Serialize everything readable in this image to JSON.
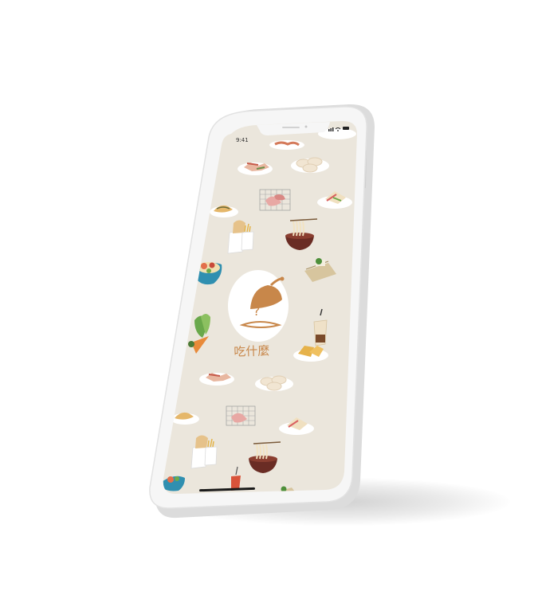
{
  "status_bar": {
    "time": "9:41"
  },
  "app": {
    "name": "吃什麼",
    "question_mark": "?",
    "brand_color": "#c8874a",
    "background_color": "#ebe6dc",
    "logo_icon": "cloche-dome-icon"
  },
  "device": {
    "frame_color": "#f4f4f4",
    "body_color": "#e9e9e9"
  },
  "food_icons": [
    "plate-dumplings-icon",
    "plate-sushi-icon",
    "grill-meat-icon",
    "plate-sandwich-icon",
    "dumpling-plate-icon",
    "fries-bag-icon",
    "noodle-bowl-icon",
    "poke-bowl-icon",
    "tofu-tray-icon",
    "bubble-tea-icon",
    "carrot-veggies-icon",
    "fried-tofu-icon",
    "soda-cup-icon"
  ]
}
